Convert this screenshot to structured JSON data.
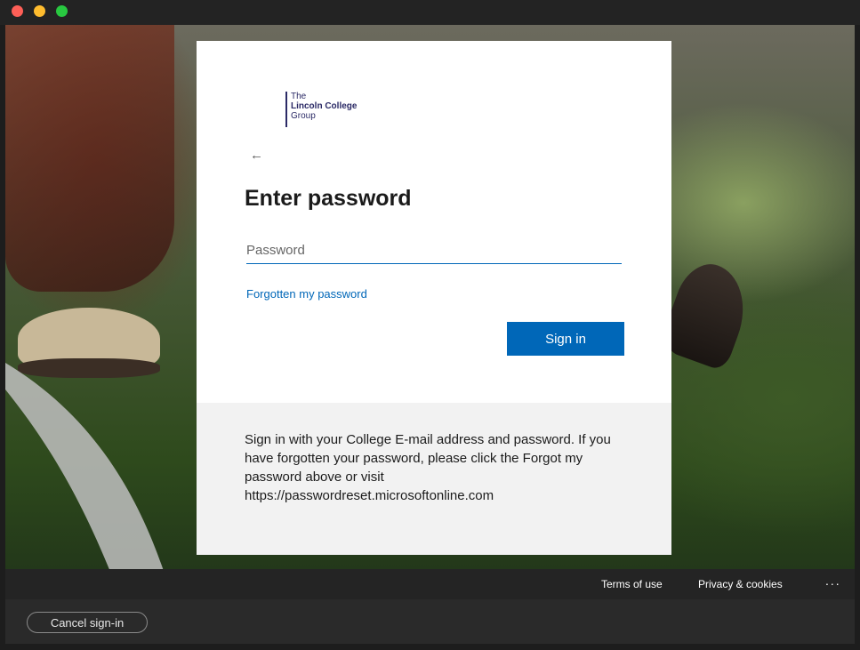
{
  "window": {
    "controls": [
      "close",
      "minimize",
      "zoom"
    ]
  },
  "logo": {
    "line1": "The",
    "line2": "Lincoln College",
    "line3": "Group"
  },
  "signin": {
    "back_icon": "arrow-left-icon",
    "back_glyph": "←",
    "heading": "Enter password",
    "password_placeholder": "Password",
    "password_value": "",
    "forgot_link": "Forgotten my password",
    "signin_button": "Sign in",
    "info_text": "Sign in with your College E-mail address and password. If you have forgotten your password, please click the Forgot my password above or visit https://passwordreset.microsoftonline.com"
  },
  "footer": {
    "terms": "Terms of use",
    "privacy": "Privacy & cookies",
    "more": "..."
  },
  "bottombar": {
    "cancel_label": "Cancel sign-in"
  },
  "colors": {
    "accent": "#0067b8",
    "brand": "#2b2a66"
  }
}
